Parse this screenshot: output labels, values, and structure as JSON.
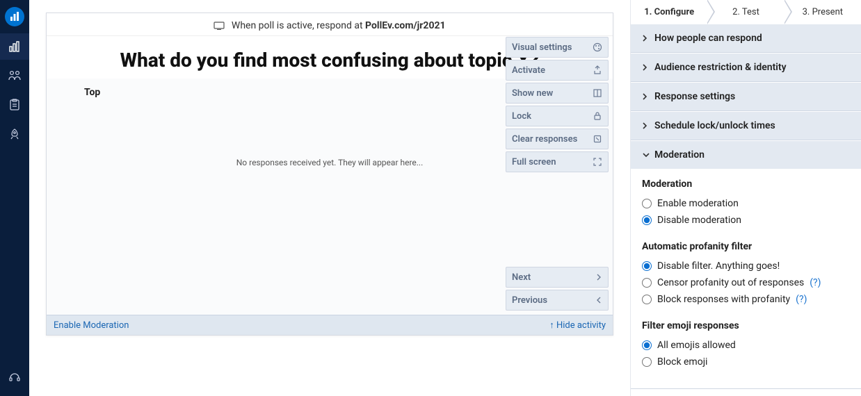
{
  "stage": {
    "respond_prefix": "When poll is active, respond at ",
    "respond_url": "PollEv.com/jr2021",
    "question": "What do you find most confusing about topic X?",
    "top_label": "Top",
    "empty_msg": "No responses received yet. They will appear here...",
    "footer_left": "Enable Moderation",
    "footer_right": "Hide activity"
  },
  "actions": {
    "visual_settings": "Visual settings",
    "activate": "Activate",
    "show_new": "Show new",
    "lock": "Lock",
    "clear": "Clear responses",
    "fullscreen": "Full screen",
    "next": "Next",
    "previous": "Previous"
  },
  "steps": {
    "s1": "1. Configure",
    "s2": "2. Test",
    "s3": "3. Present"
  },
  "accordion": {
    "how_respond": "How people can respond",
    "audience": "Audience restriction & identity",
    "response_settings": "Response settings",
    "schedule": "Schedule lock/unlock times",
    "moderation": "Moderation"
  },
  "moderation": {
    "heading": "Moderation",
    "enable": "Enable moderation",
    "disable": "Disable moderation"
  },
  "profanity": {
    "heading": "Automatic profanity filter",
    "disable": "Disable filter. Anything goes!",
    "censor": "Censor profanity out of responses",
    "block": "Block responses with profanity",
    "help": "(?)"
  },
  "emoji": {
    "heading": "Filter emoji responses",
    "allow": "All emojis allowed",
    "block": "Block emoji"
  }
}
